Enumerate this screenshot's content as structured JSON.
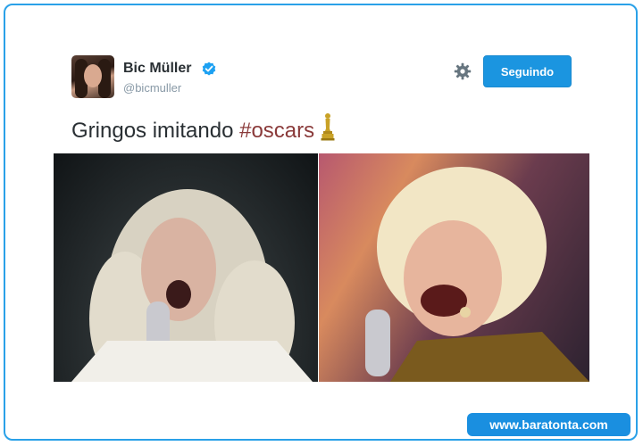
{
  "tweet": {
    "author_name": "Bic Müller",
    "author_handle": "@bicmuller",
    "follow_label": "Seguindo",
    "text_prefix": "Gringos imitando ",
    "hashtag": "#oscars",
    "icons": {
      "verified": "verified-badge-icon",
      "settings": "gear-icon",
      "emoji": "oscar-statuette-icon"
    }
  },
  "footer": {
    "watermark": "www.baratonta.com"
  },
  "colors": {
    "border": "#2aa1e8",
    "button": "#1b95e0",
    "hashtag": "#8a3a3a",
    "text": "#292f33",
    "muted": "#8899a6"
  }
}
